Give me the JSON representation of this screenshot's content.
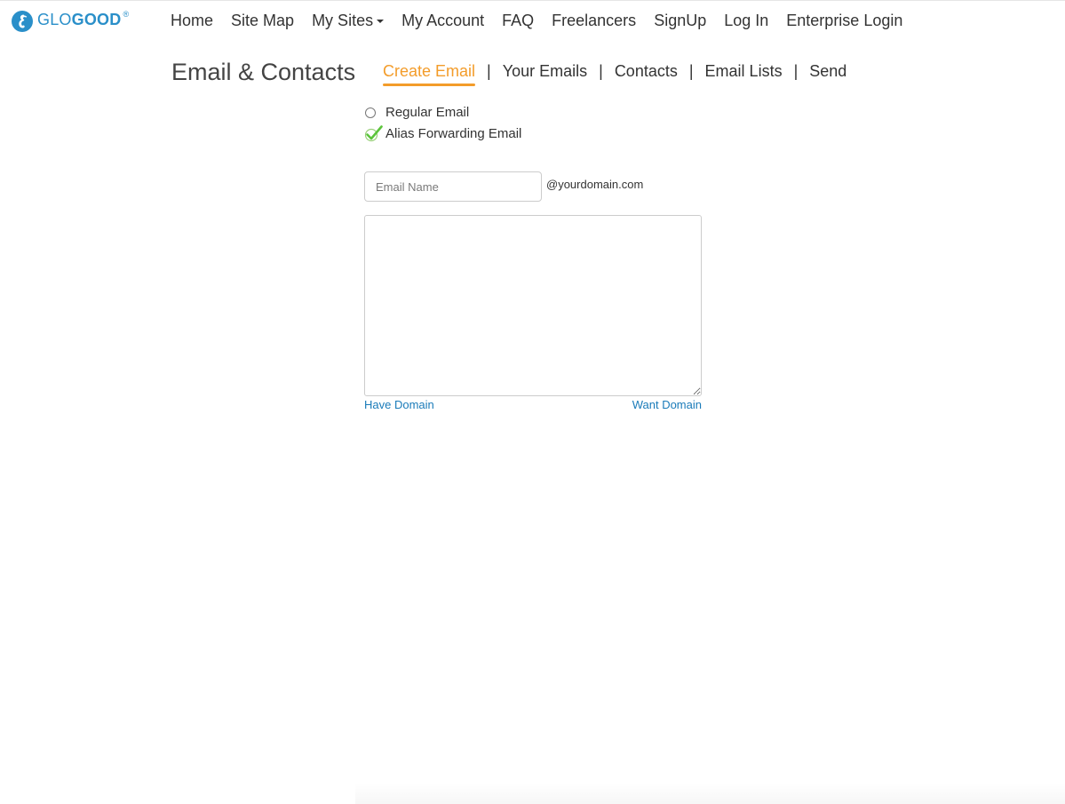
{
  "brand": {
    "name_part1": "GLO",
    "name_part2": "GOOD",
    "registered": "®",
    "accent_color": "#2a8fc9"
  },
  "nav": {
    "items": [
      {
        "label": "Home"
      },
      {
        "label": "Site Map"
      },
      {
        "label": "My Sites",
        "dropdown": true
      },
      {
        "label": "My Account"
      },
      {
        "label": "FAQ"
      },
      {
        "label": "Freelancers"
      },
      {
        "label": "SignUp"
      },
      {
        "label": "Log In"
      },
      {
        "label": "Enterprise Login"
      }
    ]
  },
  "page": {
    "title": "Email & Contacts"
  },
  "subnav": {
    "active_color": "#f39c2a",
    "separator": "|",
    "tabs": [
      {
        "label": "Create Email",
        "active": true
      },
      {
        "label": "Your Emails"
      },
      {
        "label": "Contacts"
      },
      {
        "label": "Email Lists"
      },
      {
        "label": "Send"
      }
    ]
  },
  "form": {
    "options": [
      {
        "label": "Regular Email",
        "selected": false
      },
      {
        "label": "Alias Forwarding Email",
        "selected": true
      }
    ],
    "email_name": {
      "placeholder": "Email Name",
      "value": ""
    },
    "domain_suffix": "@yourdomain.com",
    "message": "",
    "links": {
      "have_domain": "Have Domain",
      "want_domain": "Want Domain"
    }
  }
}
